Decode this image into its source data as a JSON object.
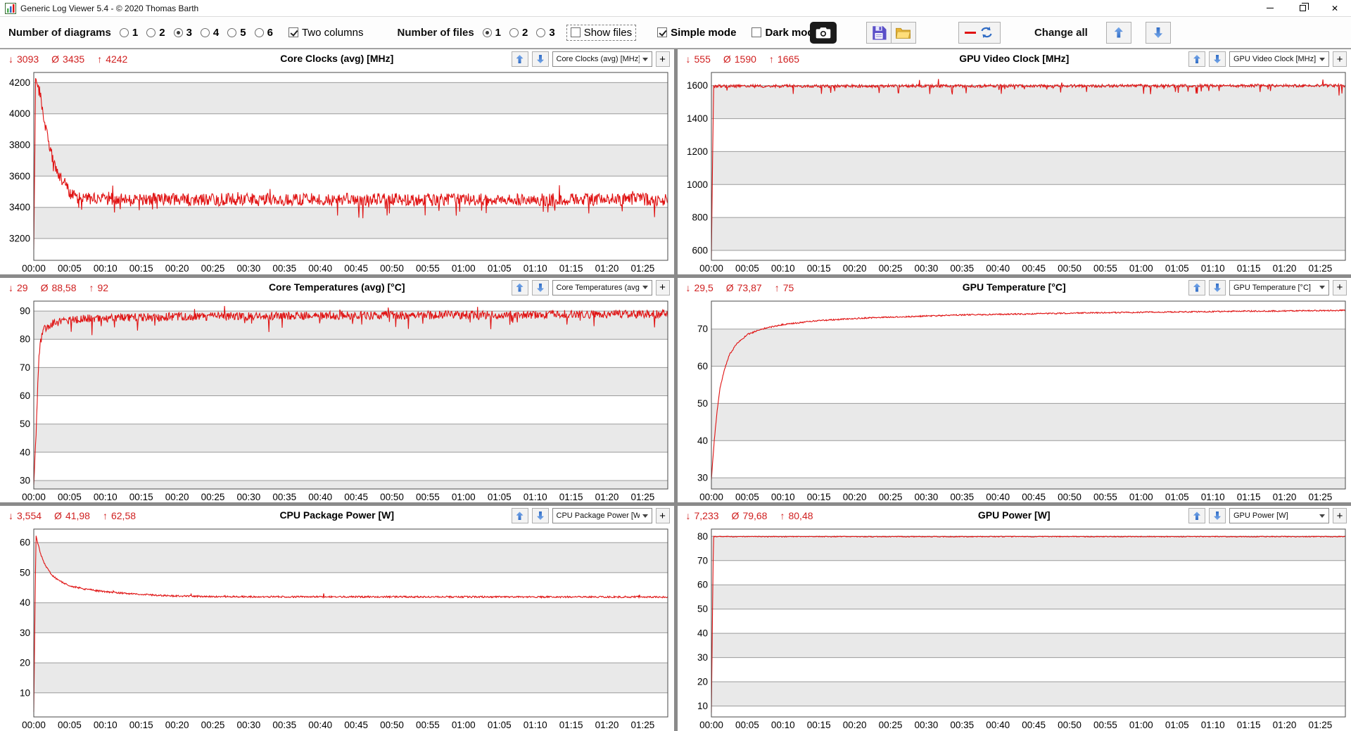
{
  "window": {
    "title": "Generic Log Viewer 5.4 - © 2020 Thomas Barth"
  },
  "icons": {
    "app": "mini-chart-icon",
    "minimize": "horizontal-line",
    "restore": "overlapping-squares",
    "close": "✕",
    "camera": "camera-glyph",
    "save": "floppy-disk-glyph",
    "open": "yellow-folder-glyph",
    "line_style": "red-line-with-refresh-arrows",
    "arrow_up": "blue-up-arrow",
    "arrow_down": "blue-down-arrow",
    "combo_caret": "▾"
  },
  "labels": {
    "plus": "+"
  },
  "stats_glyphs": {
    "min": "↓",
    "avg": "Ø",
    "max": "↑"
  },
  "toolbar": {
    "diagrams_label": "Number of diagrams",
    "diagram_options": [
      "1",
      "2",
      "3",
      "4",
      "5",
      "6"
    ],
    "diagrams_selected_index": 2,
    "two_columns_label": "Two columns",
    "two_columns_checked": true,
    "files_label": "Number of files",
    "file_options": [
      "1",
      "2",
      "3"
    ],
    "files_selected_index": 0,
    "show_files_label": "Show files",
    "show_files_checked": false,
    "simple_mode_label": "Simple mode",
    "simple_mode_checked": true,
    "dark_mode_label": "Dark mode",
    "dark_mode_checked": false,
    "change_all_label": "Change all"
  },
  "time_axis": [
    "00:00",
    "00:05",
    "00:10",
    "00:15",
    "00:20",
    "00:25",
    "00:30",
    "00:35",
    "00:40",
    "00:45",
    "00:50",
    "00:55",
    "01:00",
    "01:05",
    "01:10",
    "01:15",
    "01:20",
    "01:25"
  ],
  "charts": [
    {
      "title": "Core Clocks (avg) [MHz]",
      "stats": {
        "min": "3093",
        "avg": "3435",
        "max": "4242"
      },
      "dropdown_value": "Core Clocks (avg) [MHz]",
      "chart_data": {
        "type": "line",
        "color": "#e01212",
        "ylim": [
          3060,
          4265
        ],
        "yticks": [
          3200,
          3400,
          3600,
          3800,
          4000,
          4200
        ],
        "x_max": 88.5,
        "xtick_step": 5,
        "keypoints": [
          [
            0,
            3093
          ],
          [
            0.25,
            4242
          ],
          [
            0.9,
            4120
          ],
          [
            1.4,
            3975
          ],
          [
            2,
            3845
          ],
          [
            2.6,
            3705
          ],
          [
            3.4,
            3615
          ],
          [
            4.2,
            3565
          ],
          [
            5,
            3495
          ],
          [
            6,
            3465
          ],
          [
            8,
            3452
          ],
          [
            88.5,
            3450
          ]
        ],
        "noise": 40,
        "dip_chance": 0.05,
        "dip": 95,
        "up_chance": 0.015,
        "up": 75
      }
    },
    {
      "title": "GPU Video Clock [MHz]",
      "stats": {
        "min": "555",
        "avg": "1590",
        "max": "1665"
      },
      "dropdown_value": "GPU Video Clock [MHz]",
      "chart_data": {
        "type": "line",
        "color": "#e01212",
        "ylim": [
          540,
          1680
        ],
        "yticks": [
          600,
          800,
          1000,
          1200,
          1400,
          1600
        ],
        "x_max": 88.5,
        "xtick_step": 5,
        "keypoints": [
          [
            0,
            555
          ],
          [
            0.3,
            1597
          ],
          [
            88.5,
            1600
          ]
        ],
        "noise": 9,
        "dip_chance": 0.045,
        "dip": 52,
        "up_chance": 0.008,
        "up": 45
      }
    },
    {
      "title": "Core Temperatures (avg) [°C]",
      "stats": {
        "min": "29",
        "avg": "88,58",
        "max": "92"
      },
      "dropdown_value": "Core Temperatures (avg)",
      "chart_data": {
        "type": "line",
        "color": "#e01212",
        "ylim": [
          27,
          93.5
        ],
        "yticks": [
          30,
          40,
          50,
          60,
          70,
          80,
          90
        ],
        "x_max": 88.5,
        "xtick_step": 5,
        "keypoints": [
          [
            0,
            29
          ],
          [
            0.3,
            46
          ],
          [
            0.7,
            74
          ],
          [
            1.2,
            83
          ],
          [
            2,
            85
          ],
          [
            4,
            86.5
          ],
          [
            8,
            87.5
          ],
          [
            20,
            88
          ],
          [
            50,
            88.5
          ],
          [
            88.5,
            89
          ]
        ],
        "noise": 1.5,
        "dip_chance": 0.05,
        "dip": 5,
        "up_chance": 0.02,
        "up": 2.5
      }
    },
    {
      "title": "GPU Temperature [°C]",
      "stats": {
        "min": "29,5",
        "avg": "73,87",
        "max": "75"
      },
      "dropdown_value": "GPU Temperature [°C]",
      "chart_data": {
        "type": "line",
        "color": "#e01212",
        "ylim": [
          27,
          77.5
        ],
        "yticks": [
          30,
          40,
          50,
          60,
          70
        ],
        "x_max": 88.5,
        "xtick_step": 5,
        "keypoints": [
          [
            0,
            29.5
          ],
          [
            0.4,
            40
          ],
          [
            0.8,
            48
          ],
          [
            1.2,
            54
          ],
          [
            1.8,
            59
          ],
          [
            2.5,
            63
          ],
          [
            3.5,
            66
          ],
          [
            5,
            68.5
          ],
          [
            7,
            70
          ],
          [
            10,
            71.2
          ],
          [
            15,
            72.3
          ],
          [
            22,
            73
          ],
          [
            35,
            73.8
          ],
          [
            55,
            74.4
          ],
          [
            75,
            74.8
          ],
          [
            88.5,
            75
          ]
        ],
        "noise": 0.18
      }
    },
    {
      "title": "CPU Package Power [W]",
      "stats": {
        "min": "3,554",
        "avg": "41,98",
        "max": "62,58"
      },
      "dropdown_value": "CPU Package Power [W]",
      "chart_data": {
        "type": "line",
        "color": "#e01212",
        "ylim": [
          2,
          64.5
        ],
        "yticks": [
          10,
          20,
          30,
          40,
          50,
          60
        ],
        "x_max": 88.5,
        "xtick_step": 5,
        "keypoints": [
          [
            0,
            3.554
          ],
          [
            0.3,
            62.58
          ],
          [
            0.9,
            56.5
          ],
          [
            1.6,
            52.5
          ],
          [
            2.5,
            49.2
          ],
          [
            3.6,
            47.2
          ],
          [
            5,
            45.6
          ],
          [
            7,
            44.6
          ],
          [
            10,
            43.6
          ],
          [
            14,
            42.9
          ],
          [
            19,
            42.3
          ],
          [
            26,
            42
          ],
          [
            88.5,
            41.9
          ]
        ],
        "noise": 0.28,
        "up_chance": 0.01,
        "up": 0.9
      }
    },
    {
      "title": "GPU Power [W]",
      "stats": {
        "min": "7,233",
        "avg": "79,68",
        "max": "80,48"
      },
      "dropdown_value": "GPU Power [W]",
      "chart_data": {
        "type": "line",
        "color": "#e01212",
        "ylim": [
          5.5,
          83
        ],
        "yticks": [
          10,
          20,
          30,
          40,
          50,
          60,
          70,
          80
        ],
        "x_max": 88.5,
        "xtick_step": 5,
        "keypoints": [
          [
            0,
            7.233
          ],
          [
            0.28,
            79.9
          ],
          [
            88.5,
            79.9
          ]
        ],
        "noise": 0.18
      }
    }
  ]
}
